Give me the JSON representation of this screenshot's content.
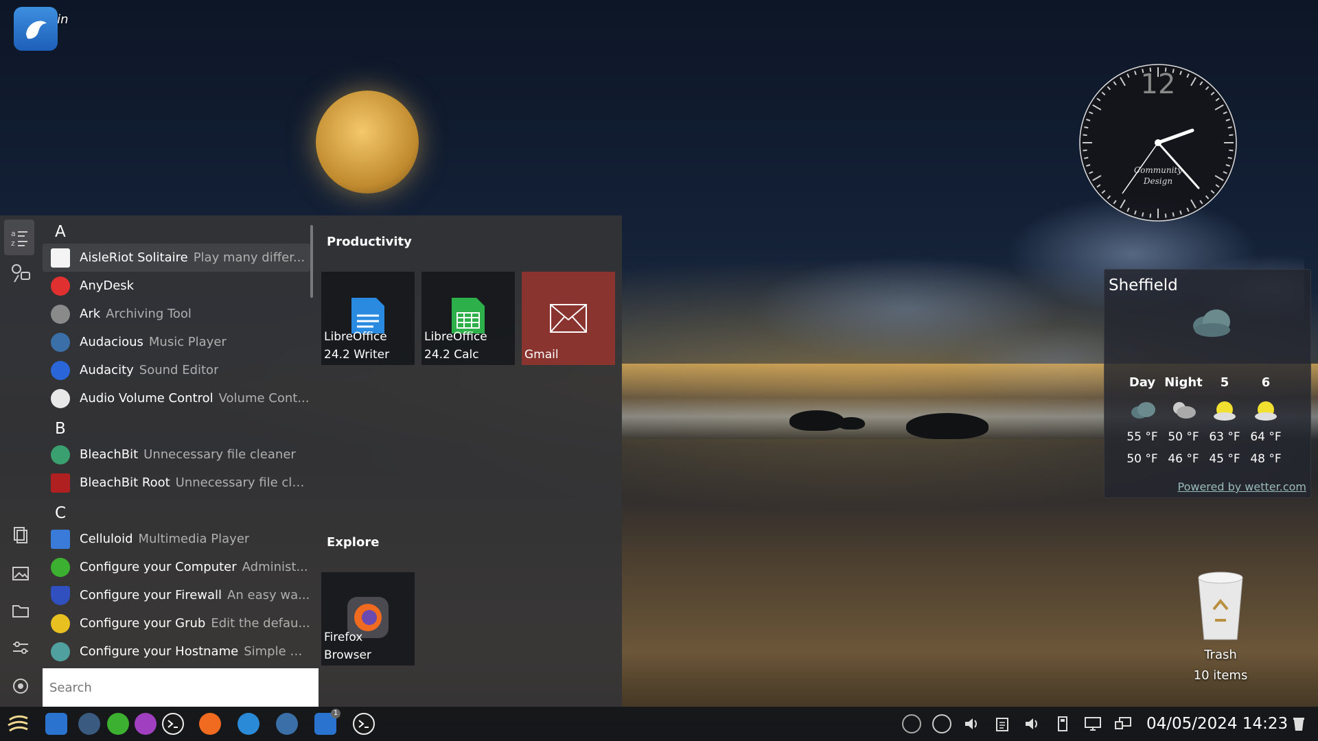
{
  "desktop": {
    "dolphin_label": "Dolphin",
    "trash_label": "Trash",
    "trash_count": "10 items"
  },
  "clock": {
    "brand_line1": "Community",
    "brand_line2": "Design",
    "twelve": "12"
  },
  "weather": {
    "city": "Sheffield",
    "headers": [
      "Day",
      "Night",
      "5",
      "6"
    ],
    "highs": [
      "55 °F",
      "50 °F",
      "63 °F",
      "64 °F"
    ],
    "lows": [
      "50 °F",
      "46 °F",
      "45 °F",
      "48 °F"
    ],
    "powered": "Powered by wetter.com"
  },
  "launcher": {
    "letters": [
      "A",
      "B",
      "C"
    ],
    "apps": [
      {
        "name": "AisleRiot Solitaire",
        "desc": "Play many differ...",
        "icon": "cards-icon",
        "color": "#ffffff"
      },
      {
        "name": "AnyDesk",
        "desc": "",
        "icon": "anydesk-icon",
        "color": "#e03030"
      },
      {
        "name": "Ark",
        "desc": "Archiving Tool",
        "icon": "ark-icon",
        "color": "#8a8a8a"
      },
      {
        "name": "Audacious",
        "desc": "Music Player",
        "icon": "audacious-icon",
        "color": "#3a6fa8"
      },
      {
        "name": "Audacity",
        "desc": "Sound Editor",
        "icon": "audacity-icon",
        "color": "#2a66d8"
      },
      {
        "name": "Audio Volume Control",
        "desc": "Volume Cont...",
        "icon": "volume-icon",
        "color": "#e8e8e8"
      },
      {
        "name": "BleachBit",
        "desc": "Unnecessary file cleaner",
        "icon": "bleachbit-icon",
        "color": "#3aa070"
      },
      {
        "name": "BleachBit Root",
        "desc": "Unnecessary file cle...",
        "icon": "bleachbit-root-icon",
        "color": "#b02020"
      },
      {
        "name": "Celluloid",
        "desc": "Multimedia Player",
        "icon": "celluloid-icon",
        "color": "#3a7ad8"
      },
      {
        "name": "Configure your Computer",
        "desc": "Administ...",
        "icon": "configure-computer-icon",
        "color": "#3cb030"
      },
      {
        "name": "Configure your Firewall",
        "desc": "An easy wa...",
        "icon": "firewall-icon",
        "color": "#3050c0"
      },
      {
        "name": "Configure your Grub",
        "desc": "Edit the defau...",
        "icon": "grub-icon",
        "color": "#e8c020"
      },
      {
        "name": "Configure your Hostname",
        "desc": "Simple G...",
        "icon": "hostname-icon",
        "color": "#50a0a0"
      }
    ],
    "sections": {
      "productivity": "Productivity",
      "explore": "Explore"
    },
    "tiles": {
      "writer": "LibreOffice\n24.2 Writer",
      "calc": "LibreOffice\n24.2 Calc",
      "gmail": "Gmail",
      "firefox": "Firefox\nBrowser"
    },
    "search_placeholder": "Search"
  },
  "taskbar": {
    "datetime": "04/05/2024 14:23",
    "badge": "1"
  }
}
